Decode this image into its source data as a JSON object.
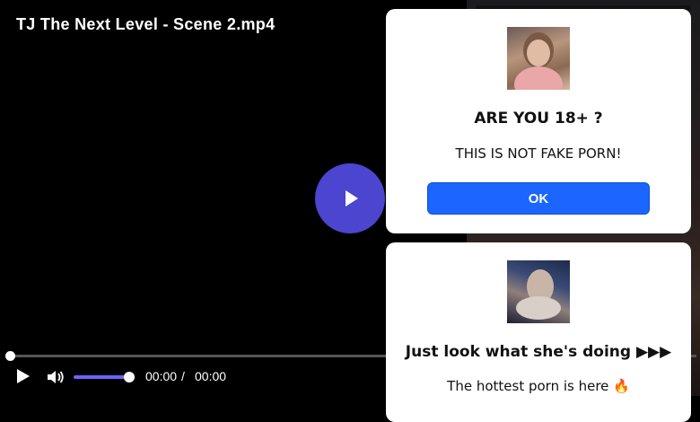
{
  "player": {
    "title": "TJ The Next Level - Scene 2.mp4",
    "current_time": "00:00",
    "separator": "/",
    "duration": "00:00",
    "play_icon": "play-icon",
    "volume_icon": "volume-icon",
    "volume_level": 1.0,
    "progress": 0
  },
  "popup_age": {
    "heading": "ARE YOU 18+ ?",
    "text": "THIS IS NOT FAKE PORN!",
    "ok_label": "OK"
  },
  "popup_ad": {
    "heading": "Just look what she's doing ▶▶▶",
    "text": "The hottest porn is here 🔥"
  },
  "colors": {
    "accent": "#4b45cf",
    "volume": "#6b63ff",
    "ok_button": "#1a66ff"
  }
}
